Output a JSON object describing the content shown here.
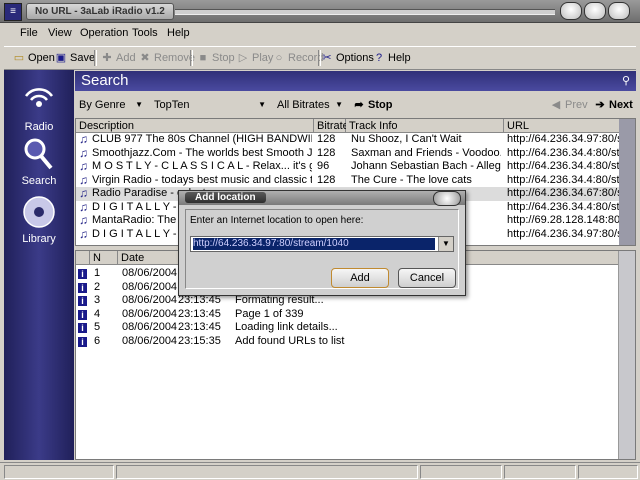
{
  "window": {
    "title": "No URL - 3aLab iRadio v1.2"
  },
  "menu": [
    "File",
    "View",
    "Operation",
    "Tools",
    "Help"
  ],
  "toolbar": {
    "open": "Open",
    "save": "Save",
    "add": "Add",
    "remove": "Remove",
    "stop": "Stop",
    "play": "Play",
    "record": "Record",
    "options": "Options",
    "help": "Help"
  },
  "sidebar": [
    {
      "label": "Radio",
      "icon": "radio-wave-icon"
    },
    {
      "label": "Search",
      "icon": "magnifier-icon"
    },
    {
      "label": "Library",
      "icon": "disc-icon"
    }
  ],
  "search": {
    "title": "Search",
    "genre": "By Genre",
    "list": "TopTen",
    "bitrate": "All Bitrates",
    "stop": "Stop",
    "prev": "Prev",
    "next": "Next"
  },
  "grid": {
    "headers": [
      "Description",
      "Bitrate",
      "Track Info",
      "URL"
    ],
    "rows": [
      {
        "desc": "CLUB 977 The 80s Channel (HIGH BANDWIDTH)",
        "bitrate": "128",
        "track": "Nu Shooz, I Can't Wait",
        "url": "http://64.236.34.97:80/st..."
      },
      {
        "desc": "Smoothjazz.Com - The worlds best Smooth Jazz - Liv...",
        "bitrate": "128",
        "track": "Saxman and Friends - Voodoo.",
        "url": "http://64.236.34.4:80/st..."
      },
      {
        "desc": "M O S T L Y - C L A S S I C A L - Relax... it's good for ...",
        "bitrate": "96",
        "track": "Johann Sebastian Bach - Allegro",
        "url": "http://64.236.34.4:80/st..."
      },
      {
        "desc": "Virgin Radio - todays best music and classic tracks, liv...",
        "bitrate": "128",
        "track": "The Cure - The love cats",
        "url": "http://64.236.34.4:80/st..."
      },
      {
        "desc": "Radio Paradise - eclect",
        "bitrate": "",
        "track": "",
        "url": "http://64.236.34.67:80/s..."
      },
      {
        "desc": "D I G I T A L L Y - I M P",
        "bitrate": "",
        "track": "",
        "url": "http://64.236.34.4:80/st..."
      },
      {
        "desc": "MantaRadio: The Q! H",
        "bitrate": "",
        "track": "ne Ga...",
        "url": "http://69.28.128.148:80/..."
      },
      {
        "desc": "D I G I T A L L Y - I M P",
        "bitrate": "",
        "track": "",
        "url": "http://64.236.34.97:80/s..."
      }
    ]
  },
  "log": {
    "headers": [
      "N",
      "Date"
    ],
    "rows": [
      {
        "n": "1",
        "date": "08/06/2004",
        "time": "",
        "msg": ""
      },
      {
        "n": "2",
        "date": "08/06/2004",
        "time": "",
        "msg": ""
      },
      {
        "n": "3",
        "date": "08/06/2004",
        "time": "23:13:45",
        "msg": "Formating result..."
      },
      {
        "n": "4",
        "date": "08/06/2004",
        "time": "23:13:45",
        "msg": "Page 1 of 339"
      },
      {
        "n": "5",
        "date": "08/06/2004",
        "time": "23:13:45",
        "msg": "Loading link details..."
      },
      {
        "n": "6",
        "date": "08/06/2004",
        "time": "23:15:35",
        "msg": "Add found URLs to list"
      }
    ]
  },
  "dialog": {
    "title": "Add location",
    "prompt": "Enter an Internet location to open here:",
    "url": "http://64.236.34.97:80/stream/1040",
    "add": "Add",
    "cancel": "Cancel"
  }
}
